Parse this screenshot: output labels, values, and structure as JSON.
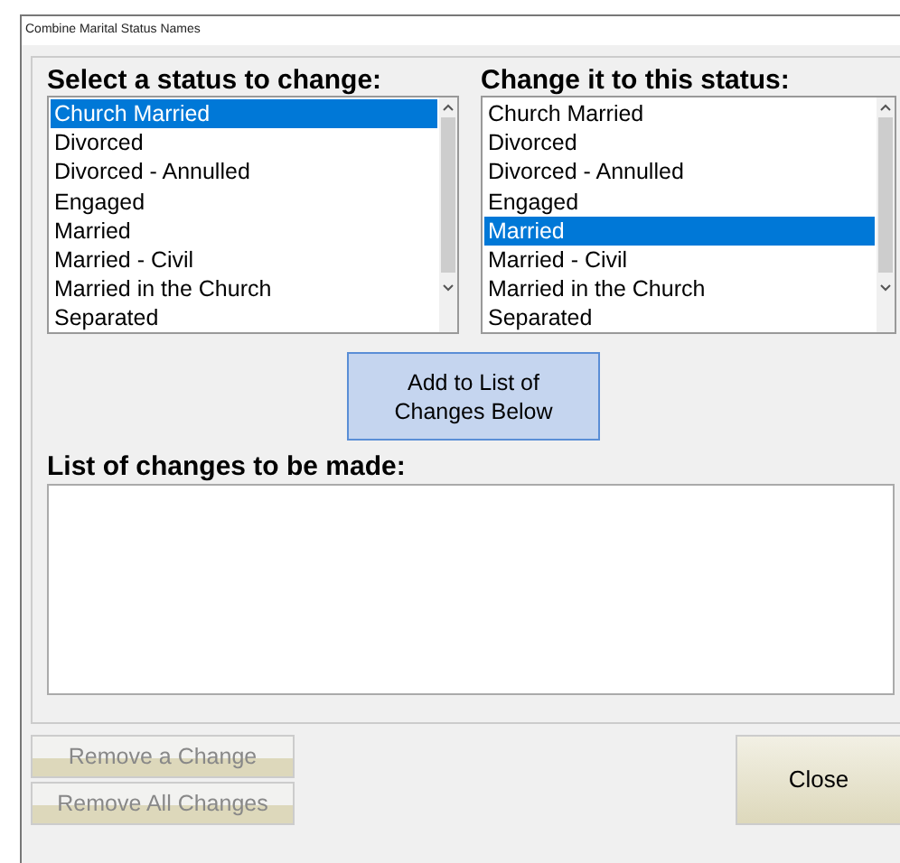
{
  "window": {
    "title": "Combine Marital Status Names"
  },
  "source_list": {
    "label": "Select a status to change:",
    "items": [
      {
        "text": "Church Married",
        "selected": true
      },
      {
        "text": "Divorced",
        "selected": false
      },
      {
        "text": "Divorced - Annulled",
        "selected": false
      },
      {
        "text": "Engaged",
        "selected": false
      },
      {
        "text": "Married",
        "selected": false
      },
      {
        "text": "Married - Civil",
        "selected": false
      },
      {
        "text": "Married in the Church",
        "selected": false
      },
      {
        "text": "Separated",
        "selected": false
      }
    ]
  },
  "target_list": {
    "label": "Change it to this status:",
    "items": [
      {
        "text": "Church Married",
        "selected": false
      },
      {
        "text": "Divorced",
        "selected": false
      },
      {
        "text": "Divorced - Annulled",
        "selected": false
      },
      {
        "text": "Engaged",
        "selected": false
      },
      {
        "text": "Married",
        "selected": true
      },
      {
        "text": "Married - Civil",
        "selected": false
      },
      {
        "text": "Married in the Church",
        "selected": false
      },
      {
        "text": "Separated",
        "selected": false
      }
    ]
  },
  "add_button": {
    "label": "Add to List of Changes Below"
  },
  "changes": {
    "label": "List of changes to be made:"
  },
  "buttons": [
    {
      "label": "Remove a Change",
      "disabled": true
    },
    {
      "label": "Remove All Changes",
      "disabled": true
    },
    {
      "label": "Close",
      "disabled": false
    }
  ]
}
